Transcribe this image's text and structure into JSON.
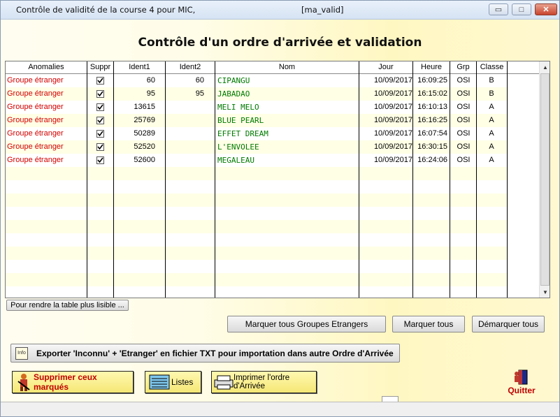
{
  "window": {
    "title": "Contrôle de validité de la course 4 pour MIC,",
    "subtitle": "[ma_valid]",
    "min_glyph": "▭",
    "max_glyph": "□",
    "close_glyph": "✕"
  },
  "heading": "Contrôle d'un ordre d'arrivée et validation",
  "table": {
    "columns": [
      "Anomalies",
      "Suppr",
      "Ident1",
      "Ident2",
      "Nom",
      "Jour",
      "Heure",
      "Grp",
      "Classe"
    ],
    "rows": [
      {
        "anomalie": "Groupe étranger",
        "suppr": true,
        "ident1": "60",
        "ident2": "60",
        "nom": "CIPANGU",
        "jour": "10/09/2017",
        "heure": "16:09:25",
        "grp": "OSI",
        "classe": "B"
      },
      {
        "anomalie": "Groupe étranger",
        "suppr": true,
        "ident1": "95",
        "ident2": "95",
        "nom": "JABADAO",
        "jour": "10/09/2017",
        "heure": "16:15:02",
        "grp": "OSI",
        "classe": "B"
      },
      {
        "anomalie": "Groupe étranger",
        "suppr": true,
        "ident1": "13615",
        "ident2": "",
        "nom": "MELI MELO",
        "jour": "10/09/2017",
        "heure": "16:10:13",
        "grp": "OSI",
        "classe": "A"
      },
      {
        "anomalie": "Groupe étranger",
        "suppr": true,
        "ident1": "25769",
        "ident2": "",
        "nom": "BLUE PEARL",
        "jour": "10/09/2017",
        "heure": "16:16:25",
        "grp": "OSI",
        "classe": "A"
      },
      {
        "anomalie": "Groupe étranger",
        "suppr": true,
        "ident1": "50289",
        "ident2": "",
        "nom": "EFFET DREAM",
        "jour": "10/09/2017",
        "heure": "16:07:54",
        "grp": "OSI",
        "classe": "A"
      },
      {
        "anomalie": "Groupe étranger",
        "suppr": true,
        "ident1": "52520",
        "ident2": "",
        "nom": "L'ENVOLEE",
        "jour": "10/09/2017",
        "heure": "16:30:15",
        "grp": "OSI",
        "classe": "A"
      },
      {
        "anomalie": "Groupe étranger",
        "suppr": true,
        "ident1": "52600",
        "ident2": "",
        "nom": "MEGALEAU",
        "jour": "10/09/2017",
        "heure": "16:24:06",
        "grp": "OSI",
        "classe": "A"
      }
    ]
  },
  "buttons": {
    "lisible": "Pour rendre la table plus lisible ...",
    "marquer_etrangers": "Marquer tous Groupes Etrangers",
    "marquer_tous": "Marquer tous",
    "demarquer_tous": "Démarquer tous",
    "exporter": "Exporter 'Inconnu' + 'Etranger' en fichier TXT pour importation dans autre Ordre d'Arrivée",
    "supprimer": "Supprimer ceux marqués",
    "listes": "Listes",
    "imprimer": "Imprimer l'ordre d'Arrivée",
    "quitter": "Quitter"
  },
  "icons": {
    "info_label": "Info"
  },
  "colors": {
    "anomaly": "#d20000",
    "name": "#007a00",
    "quit": "#c00000"
  }
}
